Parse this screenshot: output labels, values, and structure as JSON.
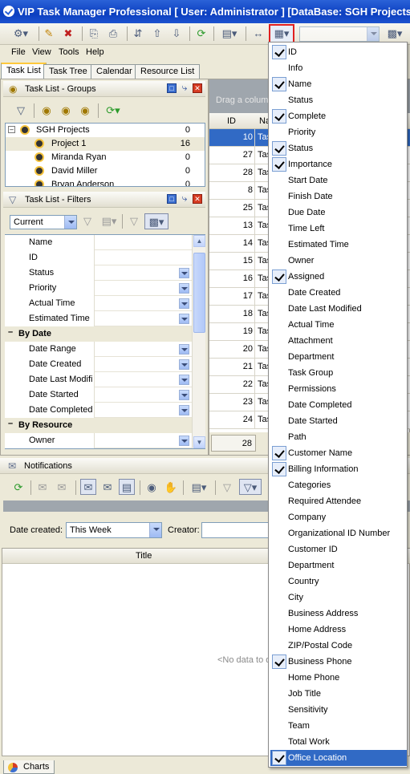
{
  "window": {
    "title": "VIP Task Manager Professional [ User: Administrator ] [DataBase: SGH Projects]"
  },
  "colors": {
    "title_bar": "#0b3fc0",
    "selection": "#316ac5",
    "highlight_border": "#e02020"
  },
  "toolbar": {
    "icons": [
      "task-add-icon",
      "task-edit-icon",
      "task-delete-icon",
      "task-copy-icon",
      "task-print-icon",
      "move-up-down-icon",
      "move-up-icon",
      "move-down-icon",
      "refresh-icon",
      "view-options-icon",
      "fit-columns-icon",
      "column-chooser-icon",
      "layout-icon"
    ],
    "combo_value": ""
  },
  "menubar": {
    "items": [
      "File",
      "View",
      "Tools",
      "Help"
    ]
  },
  "tabs": [
    "Task List",
    "Task Tree",
    "Calendar",
    "Resource List"
  ],
  "groups_panel": {
    "title": "Task List - Groups",
    "items": [
      {
        "label": "SGH Projects",
        "count": "0",
        "type": "root"
      },
      {
        "label": "Project 1",
        "count": "16",
        "type": "project"
      },
      {
        "label": "Miranda Ryan",
        "count": "0",
        "type": "person"
      },
      {
        "label": "David Miller",
        "count": "0",
        "type": "person"
      },
      {
        "label": "Bryan Anderson",
        "count": "0",
        "type": "person"
      }
    ]
  },
  "filters_panel": {
    "title": "Task List - Filters",
    "current": "Current",
    "rows": [
      {
        "kind": "row",
        "label": "Name",
        "dropdown": false
      },
      {
        "kind": "row",
        "label": "ID",
        "dropdown": false
      },
      {
        "kind": "row",
        "label": "Status",
        "dropdown": true
      },
      {
        "kind": "row",
        "label": "Priority",
        "dropdown": true
      },
      {
        "kind": "row",
        "label": "Actual Time",
        "dropdown": true
      },
      {
        "kind": "row",
        "label": "Estimated Time",
        "dropdown": true
      },
      {
        "kind": "cat",
        "label": "By Date"
      },
      {
        "kind": "row",
        "label": "Date Range",
        "dropdown": true
      },
      {
        "kind": "row",
        "label": "Date Created",
        "dropdown": true
      },
      {
        "kind": "row",
        "label": "Date Last Modifi",
        "dropdown": true
      },
      {
        "kind": "row",
        "label": "Date Started",
        "dropdown": true
      },
      {
        "kind": "row",
        "label": "Date Completed",
        "dropdown": true
      },
      {
        "kind": "cat",
        "label": "By Resource"
      },
      {
        "kind": "row",
        "label": "Owner",
        "dropdown": true
      }
    ]
  },
  "grid": {
    "group_hint": "Drag a column",
    "columns": [
      "ID",
      "Na"
    ],
    "rows": [
      {
        "id": "10",
        "name": "Tas",
        "selected": true
      },
      {
        "id": "27",
        "name": "Tas"
      },
      {
        "id": "28",
        "name": "Tas"
      },
      {
        "id": "8",
        "name": "Tas"
      },
      {
        "id": "25",
        "name": "Tas"
      },
      {
        "id": "13",
        "name": "Tas"
      },
      {
        "id": "14",
        "name": "Tas"
      },
      {
        "id": "15",
        "name": "Tas"
      },
      {
        "id": "16",
        "name": "Tas"
      },
      {
        "id": "17",
        "name": "Tas"
      },
      {
        "id": "18",
        "name": "Tas"
      },
      {
        "id": "19",
        "name": "Tas"
      },
      {
        "id": "20",
        "name": "Tas"
      },
      {
        "id": "21",
        "name": "Tas"
      },
      {
        "id": "22",
        "name": "Tas"
      },
      {
        "id": "23",
        "name": "Tas"
      },
      {
        "id": "24",
        "name": "Tas"
      }
    ],
    "footer_count": "28"
  },
  "column_menu": {
    "items": [
      {
        "label": "ID",
        "checked": true
      },
      {
        "label": "Info",
        "checked": false
      },
      {
        "label": "Name",
        "checked": true
      },
      {
        "label": "Status",
        "checked": false
      },
      {
        "label": "Complete",
        "checked": true
      },
      {
        "label": "Priority",
        "checked": false
      },
      {
        "label": "Status",
        "checked": true
      },
      {
        "label": "Importance",
        "checked": true
      },
      {
        "label": "Start Date",
        "checked": false
      },
      {
        "label": "Finish Date",
        "checked": false
      },
      {
        "label": "Due Date",
        "checked": false
      },
      {
        "label": "Time Left",
        "checked": false
      },
      {
        "label": "Estimated Time",
        "checked": false
      },
      {
        "label": "Owner",
        "checked": false
      },
      {
        "label": "Assigned",
        "checked": true
      },
      {
        "label": "Date Created",
        "checked": false
      },
      {
        "label": "Date Last Modified",
        "checked": false
      },
      {
        "label": "Actual Time",
        "checked": false
      },
      {
        "label": "Attachment",
        "checked": false
      },
      {
        "label": "Department",
        "checked": false
      },
      {
        "label": "Task Group",
        "checked": false
      },
      {
        "label": "Permissions",
        "checked": false
      },
      {
        "label": "Date Completed",
        "checked": false
      },
      {
        "label": "Date Started",
        "checked": false
      },
      {
        "label": "Path",
        "checked": false
      },
      {
        "label": "Customer Name",
        "checked": true
      },
      {
        "label": "Billing Information",
        "checked": true
      },
      {
        "label": "Categories",
        "checked": false
      },
      {
        "label": "Required Attendee",
        "checked": false
      },
      {
        "label": "Company",
        "checked": false
      },
      {
        "label": "Organizational ID Number",
        "checked": false
      },
      {
        "label": "Customer ID",
        "checked": false
      },
      {
        "label": "Department",
        "checked": false
      },
      {
        "label": "Country",
        "checked": false
      },
      {
        "label": "City",
        "checked": false
      },
      {
        "label": "Business Address",
        "checked": false
      },
      {
        "label": "Home Address",
        "checked": false
      },
      {
        "label": "ZIP/Postal Code",
        "checked": false
      },
      {
        "label": "Business Phone",
        "checked": true
      },
      {
        "label": "Home Phone",
        "checked": false
      },
      {
        "label": "Job Title",
        "checked": false
      },
      {
        "label": "Sensitivity",
        "checked": false
      },
      {
        "label": "Team",
        "checked": false
      },
      {
        "label": "Total Work",
        "checked": false
      },
      {
        "label": "Office Location",
        "checked": true,
        "highlighted": true
      }
    ]
  },
  "notifications": {
    "title": "Notifications",
    "date_created_label": "Date created:",
    "date_created_value": "This Week",
    "creator_label": "Creator:",
    "creator_value": "",
    "column_title": "Title",
    "empty_text": "<No data to d"
  },
  "bottom_tab": {
    "label": "Charts"
  }
}
